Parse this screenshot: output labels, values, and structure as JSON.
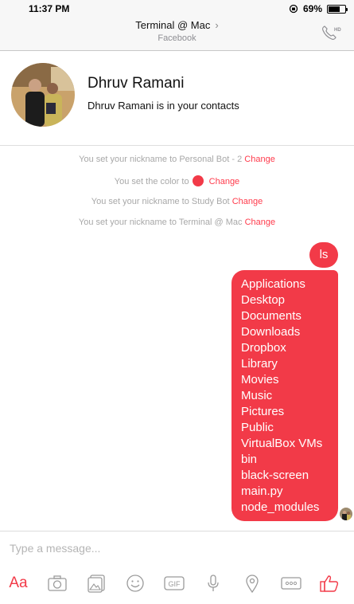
{
  "status_bar": {
    "time": "11:37 PM",
    "battery_percent": "69%",
    "battery_level": 0.69
  },
  "header": {
    "title": "Terminal @ Mac",
    "subtitle": "Facebook",
    "call_icon": "phone-hd-icon"
  },
  "contact": {
    "name": "Dhruv Ramani",
    "note": "Dhruv Ramani is in your contacts"
  },
  "system_messages": [
    {
      "text": "You set your nickname to Personal Bot - 2",
      "action": "Change"
    },
    {
      "text": "You set the color to",
      "action": "Change",
      "color": "#f23a48"
    },
    {
      "text": "You set your nickname to Study Bot",
      "action": "Change"
    },
    {
      "text": "You set your nickname to Terminal @ Mac",
      "action": "Change"
    }
  ],
  "messages": {
    "sent_command": "ls",
    "output_lines": [
      "Applications",
      "Desktop",
      "Documents",
      "Downloads",
      "Dropbox",
      "Library",
      "Movies",
      "Music",
      "Pictures",
      "Public",
      "VirtualBox VMs",
      "bin",
      "black-screen",
      "main.py",
      "node_modules"
    ]
  },
  "composer": {
    "placeholder": "Type a message...",
    "text_button": "Aa",
    "tools": [
      "camera-icon",
      "photos-icon",
      "emoji-icon",
      "gif-icon",
      "microphone-icon",
      "location-icon",
      "more-icon",
      "thumbs-up-icon"
    ],
    "gif_label": "GIF"
  },
  "colors": {
    "accent": "#f23a48",
    "link": "#ff3b4c",
    "muted": "#a8a8a8"
  }
}
